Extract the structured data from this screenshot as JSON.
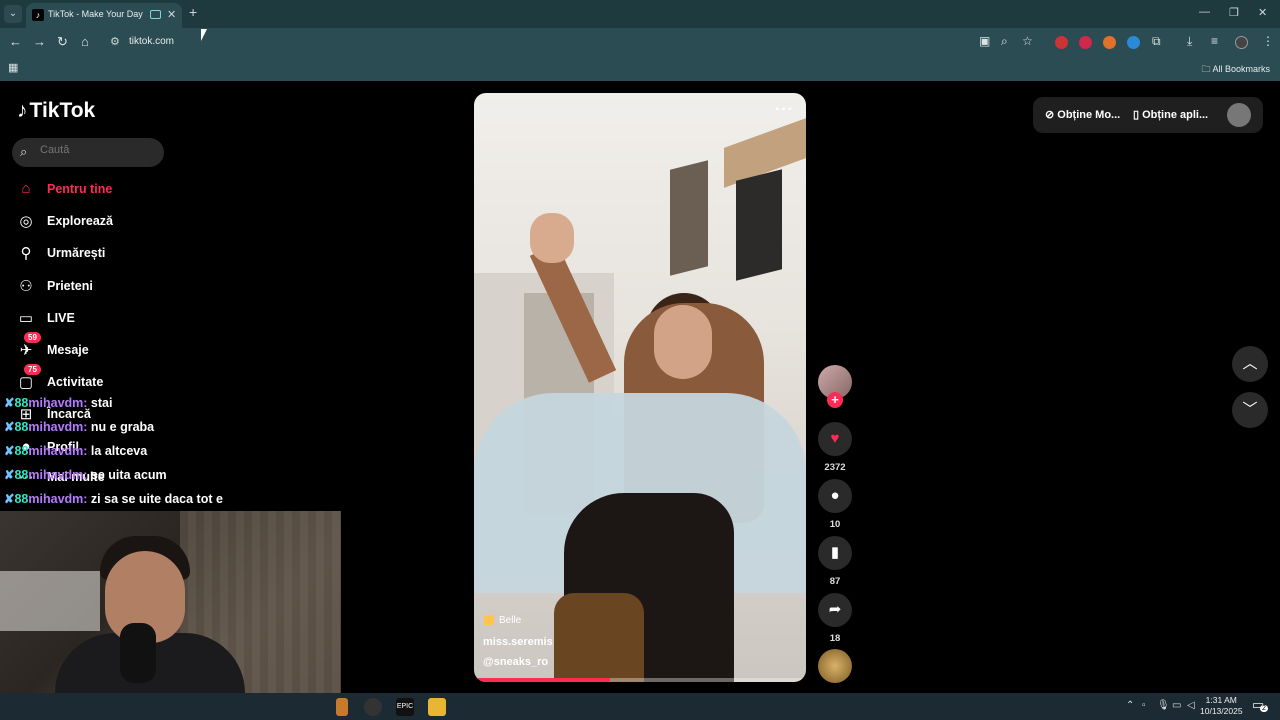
{
  "browser": {
    "tab_title": "TikTok - Make Your Day",
    "tab_favicon": "tiktok-favicon",
    "url": "tiktok.com",
    "all_bookmarks": "All Bookmarks",
    "window_controls": [
      "minimize",
      "restore",
      "close"
    ]
  },
  "sidebar": {
    "logo": "TikTok",
    "search_placeholder": "Caută",
    "items": [
      {
        "label": "Pentru tine",
        "icon": "home-icon",
        "active": true
      },
      {
        "label": "Explorează",
        "icon": "compass-icon"
      },
      {
        "label": "Urmărești",
        "icon": "following-icon"
      },
      {
        "label": "Prieteni",
        "icon": "friends-icon"
      },
      {
        "label": "LIVE",
        "icon": "live-icon"
      },
      {
        "label": "Mesaje",
        "icon": "messages-icon",
        "badge": "59"
      },
      {
        "label": "Activitate",
        "icon": "activity-icon",
        "badge": "75"
      },
      {
        "label": "Încarcă",
        "icon": "upload-icon"
      },
      {
        "label": "Profil",
        "icon": "profile-icon"
      },
      {
        "label": "Mai multe",
        "icon": "more-icon"
      }
    ]
  },
  "chat": {
    "messages": [
      {
        "user": "mihavdm:",
        "text": "stai"
      },
      {
        "user": "mihavdm:",
        "text": "nu e graba"
      },
      {
        "user": "mihavdm:",
        "text": "la altceva"
      },
      {
        "user": "mihavdm:",
        "text": "se uita acum"
      },
      {
        "user": "mihavdm:",
        "text": "zi sa se uite daca tot e"
      }
    ]
  },
  "video": {
    "tag": "Belle",
    "username": "miss.seremis",
    "caption": "@sneaks_ro",
    "progress": 0.41
  },
  "actions": {
    "likes": "2372",
    "comments": "10",
    "saves": "87",
    "shares": "18"
  },
  "topright": {
    "get_coins": "Obține Mo...",
    "get_app": "Obține apli..."
  },
  "taskbar": {
    "time": "1:31 AM",
    "date": "10/13/2025",
    "notifications": "2"
  },
  "colors": {
    "accent": "#fe2c55",
    "chrome_bg": "#2b4c52",
    "tabbar_bg": "#1f3a3f"
  }
}
